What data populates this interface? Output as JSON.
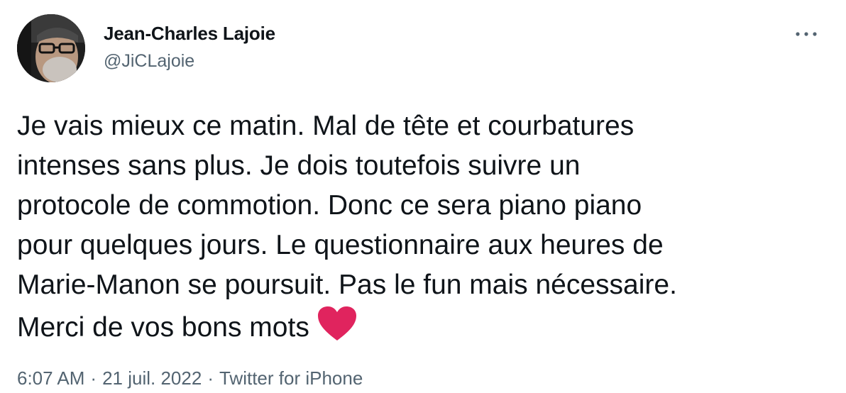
{
  "author": {
    "display_name": "Jean-Charles Lajoie",
    "handle": "@JiCLajoie",
    "avatar_icon": "profile-photo"
  },
  "more_icon": "more-horizontal-icon",
  "tweet": {
    "lines": [
      "Je vais mieux ce matin. Mal de tête et courbatures",
      "intenses sans plus. Je dois toutefois suivre un",
      "protocole de commotion. Donc ce sera piano piano",
      "pour quelques jours. Le questionnaire aux heures de",
      "Marie-Manon se poursuit. Pas le fun mais nécessaire.",
      "Merci de vos bons mots"
    ],
    "emoji": "heart-emoji"
  },
  "meta": {
    "time": "6:07 AM",
    "date": "21 juil. 2022",
    "source": "Twitter for iPhone",
    "separator": "·"
  },
  "colors": {
    "text": "#0f1419",
    "secondary": "#536471",
    "heart": "#e0245e"
  }
}
